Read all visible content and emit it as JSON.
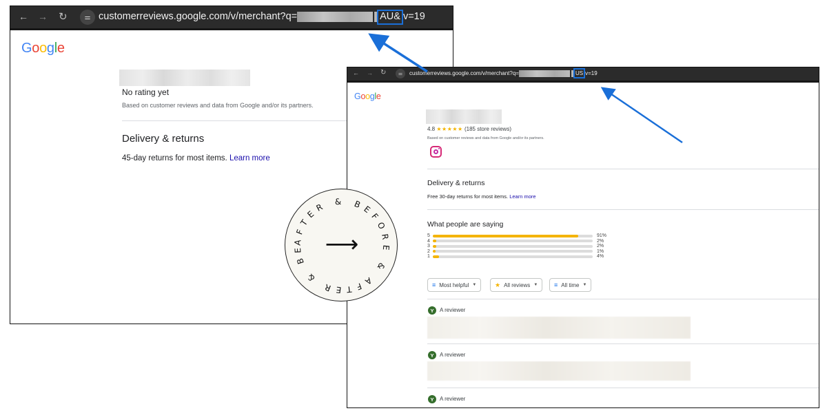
{
  "before": {
    "url_prefix": "customerreviews.google.com/v/merchant?q=",
    "url_highlight": "AU&",
    "url_suffix": "v=19",
    "logo": [
      "G",
      "o",
      "o",
      "g",
      "l",
      "e"
    ],
    "rating_text": "No rating yet",
    "based_on": "Based on customer reviews and data from Google and/or its partners.",
    "delivery_heading": "Delivery & returns",
    "delivery_text": "45-day returns for most items.",
    "learn_more": "Learn more"
  },
  "after": {
    "url_prefix": "customerreviews.google.com/v/merchant?q=",
    "url_highlight": "US",
    "url_suffix": "v=19",
    "logo": [
      "G",
      "o",
      "o",
      "g",
      "l",
      "e"
    ],
    "rating_value": "4.8",
    "stars": "★★★★★",
    "review_count": "(185 store reviews)",
    "based_on": "Based on customer reviews and data from Google and/or its partners.",
    "delivery_heading": "Delivery & returns",
    "delivery_text": "Free 30-day returns for most items.",
    "learn_more": "Learn more",
    "people_heading": "What people are saying",
    "distribution": [
      {
        "stars": "5",
        "fraction": 0.91,
        "label": "91%"
      },
      {
        "stars": "4",
        "fraction": 0.02,
        "label": "2%"
      },
      {
        "stars": "3",
        "fraction": 0.02,
        "label": "2%"
      },
      {
        "stars": "2",
        "fraction": 0.01,
        "label": "1%"
      },
      {
        "stars": "1",
        "fraction": 0.04,
        "label": "4%"
      }
    ],
    "filters": {
      "sort": "Most helpful",
      "reviews": "All reviews",
      "time": "All time"
    },
    "reviewer_initial": "Y",
    "reviewers": [
      "A reviewer",
      "A reviewer",
      "A reviewer"
    ]
  },
  "badge": {
    "before_label": "BEFORE",
    "after_label": "AFTER",
    "amp": "&",
    "arrow": "⟶"
  },
  "colors": {
    "google_blue": "#4285F4",
    "google_red": "#EA4335",
    "google_yellow": "#FBBC05",
    "google_green": "#34A853",
    "star": "#F4B400",
    "highlight": "#1A6FD8",
    "link": "#1A0DAB"
  },
  "icons": [
    "back-arrow-icon",
    "forward-arrow-icon",
    "reload-icon",
    "site-settings-icon",
    "instagram-icon",
    "sort-icon",
    "star-icon",
    "filter-icon",
    "caret-down-icon",
    "pointer-arrow-icon"
  ]
}
